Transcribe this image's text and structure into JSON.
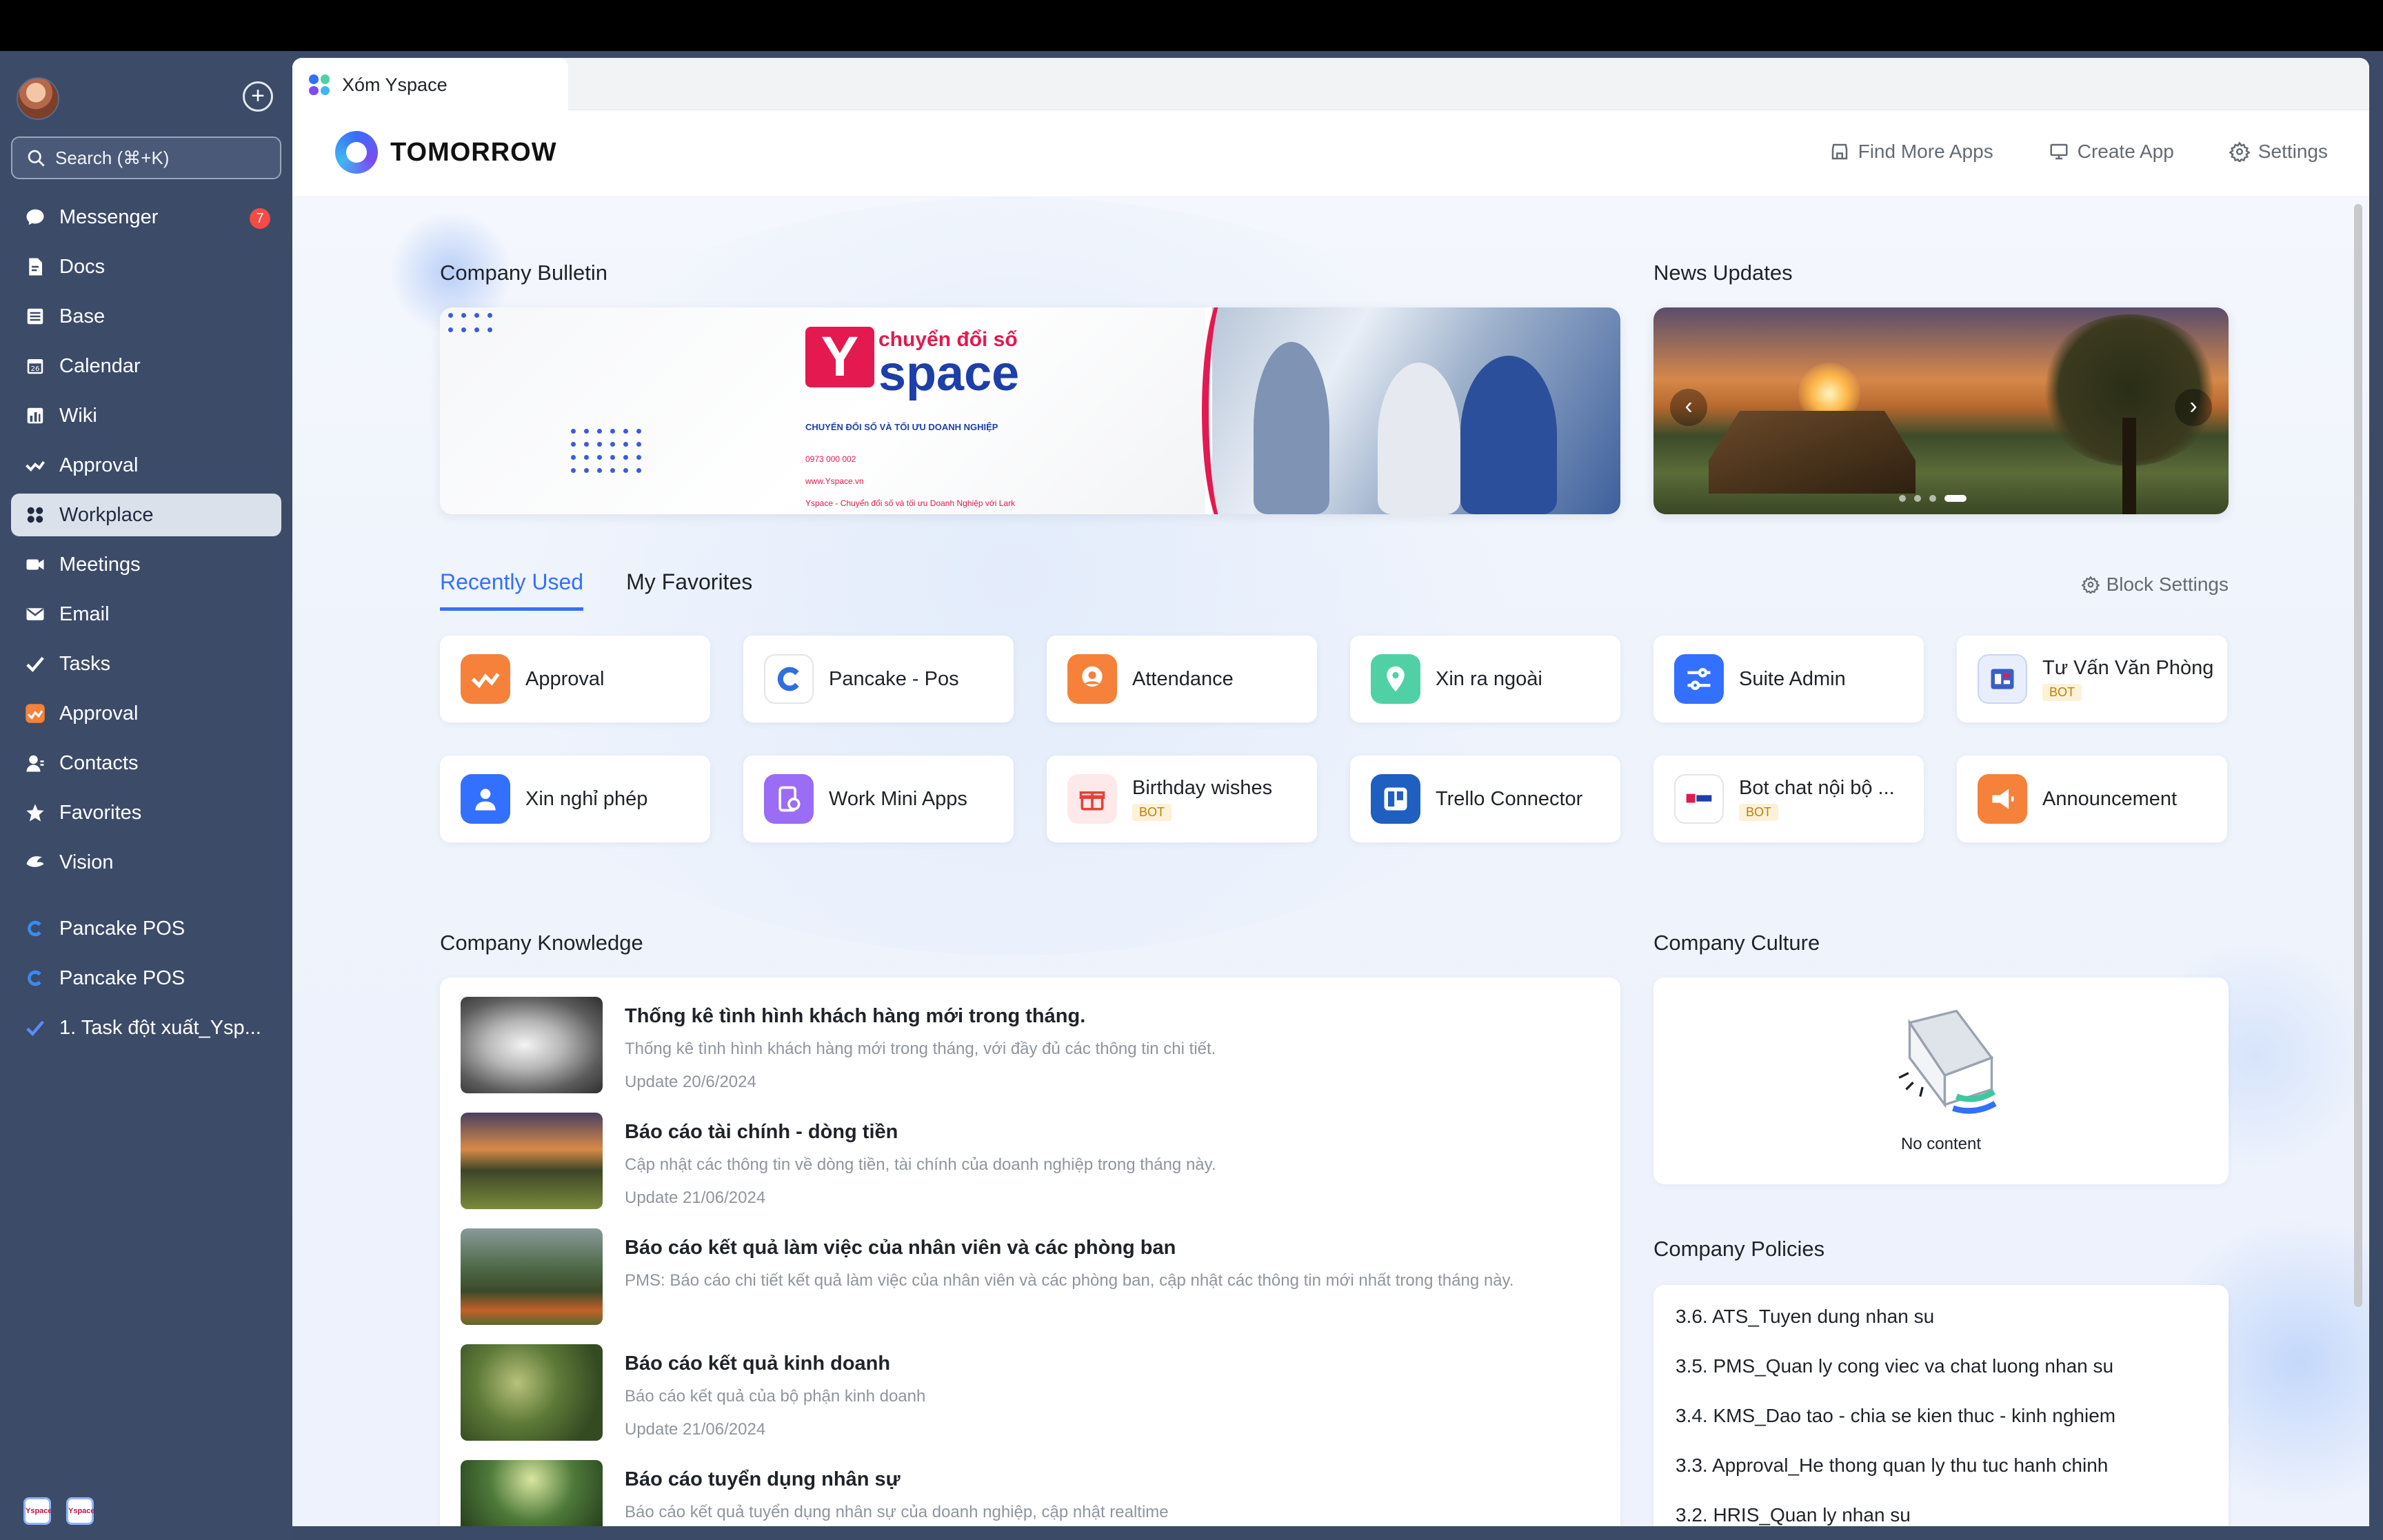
{
  "sidebar": {
    "search_label": "Search (⌘+K)",
    "items": [
      {
        "label": "Messenger",
        "icon": "chat-icon",
        "badge": "7"
      },
      {
        "label": "Docs",
        "icon": "docs-icon"
      },
      {
        "label": "Base",
        "icon": "base-icon"
      },
      {
        "label": "Calendar",
        "icon": "calendar-icon"
      },
      {
        "label": "Wiki",
        "icon": "wiki-icon"
      },
      {
        "label": "Approval",
        "icon": "approval-icon"
      },
      {
        "label": "Workplace",
        "icon": "workplace-icon",
        "active": true
      },
      {
        "label": "Meetings",
        "icon": "video-icon"
      },
      {
        "label": "Email",
        "icon": "mail-icon"
      },
      {
        "label": "Tasks",
        "icon": "check-icon"
      },
      {
        "label": "Approval",
        "icon": "approval-app-icon"
      },
      {
        "label": "Contacts",
        "icon": "contacts-icon"
      },
      {
        "label": "Favorites",
        "icon": "star-icon"
      },
      {
        "label": "Vision",
        "icon": "vision-icon"
      }
    ],
    "pinned": [
      {
        "label": "Pancake POS"
      },
      {
        "label": "Pancake POS"
      },
      {
        "label": "1. Task đột xuất_Ysp..."
      }
    ]
  },
  "window": {
    "tab_title": "Xóm Yspace"
  },
  "header": {
    "brand": "TOMORROW",
    "find_more_apps": "Find More Apps",
    "create_app": "Create App",
    "settings": "Settings"
  },
  "bulletin": {
    "title": "Company Bulletin",
    "banner": {
      "top": "chuyển đổi số",
      "y": "Y",
      "space": "space",
      "subtitle": "CHUYỂN ĐỔI SỐ VÀ TỐI ƯU DOANH NGHIỆP",
      "phone": "0973 000 002",
      "web": "www.Yspace.vn",
      "fb": "Yspace - Chuyển đổi số và tối ưu Doanh Nghiệp với Lark"
    }
  },
  "news": {
    "title": "News Updates",
    "prev": "‹",
    "next": "›",
    "pages": 4,
    "current_page": 4
  },
  "apps_section": {
    "tabs": [
      "Recently Used",
      "My Favorites"
    ],
    "active_tab": 0,
    "block_settings": "Block Settings",
    "apps": [
      {
        "name": "Approval",
        "icon": "approval-app-icon",
        "color": "#f5813a",
        "bot": ""
      },
      {
        "name": "Pancake - Pos",
        "icon": "pancake-icon",
        "color": "#ffffff",
        "bot": ""
      },
      {
        "name": "Attendance",
        "icon": "attendance-icon",
        "color": "#f5813a",
        "bot": ""
      },
      {
        "name": "Xin ra ngoài",
        "icon": "location-icon",
        "color": "#4fd1a5",
        "bot": ""
      },
      {
        "name": "Suite Admin",
        "icon": "admin-icon",
        "color": "#3370ff",
        "bot": ""
      },
      {
        "name": "Tư Vấn Văn Phòng",
        "icon": "office-bot-icon",
        "color": "#e8eefc",
        "bot": "BOT"
      },
      {
        "name": "Xin nghỉ phép",
        "icon": "leave-icon",
        "color": "#3370ff",
        "bot": ""
      },
      {
        "name": "Work Mini Apps",
        "icon": "mini-apps-icon",
        "color": "#9b6cf5",
        "bot": ""
      },
      {
        "name": "Birthday wishes",
        "icon": "gift-icon",
        "color": "#fde9e9",
        "bot": "BOT"
      },
      {
        "name": "Trello Connector",
        "icon": "trello-icon",
        "color": "#1f5fbf",
        "bot": ""
      },
      {
        "name": "Bot chat nội bộ ...",
        "icon": "yspace-bot-icon",
        "color": "#ffffff",
        "bot": "BOT"
      },
      {
        "name": "Announcement",
        "icon": "megaphone-icon",
        "color": "#f5813a",
        "bot": ""
      }
    ]
  },
  "knowledge": {
    "title": "Company Knowledge",
    "items": [
      {
        "title": "Thống kê tình hình khách hàng mới trong tháng.",
        "desc": "Thống kê tình hình khách hàng mới trong tháng, với đầy đủ các thông tin chi tiết.",
        "date": "Update 20/6/2024"
      },
      {
        "title": "Báo cáo tài chính - dòng tiền",
        "desc": "Cập nhật các thông tin về dòng tiền, tài chính của doanh nghiệp trong tháng này.",
        "date": "Update 21/06/2024"
      },
      {
        "title": "Báo cáo kết quả làm việc của nhân viên và các phòng ban",
        "desc": "PMS: Báo cáo chi tiết kết quả làm việc của nhân viên và các phòng ban, cập nhật các thông tin mới nhất trong tháng này.",
        "date": ""
      },
      {
        "title": "Báo cáo kết quả kinh doanh",
        "desc": "Báo cáo kết quả của bộ phận kinh doanh",
        "date": "Update 21/06/2024"
      },
      {
        "title": "Báo cáo tuyển dụng nhân sự",
        "desc": "Báo cáo kết quả tuyển dụng nhân sự của doanh nghiệp, cập nhật realtime",
        "date": ""
      }
    ]
  },
  "culture": {
    "title": "Company Culture",
    "empty": "No content"
  },
  "policies": {
    "title": "Company Policies",
    "items": [
      "3.6. ATS_Tuyen dung nhan su",
      "3.5. PMS_Quan ly cong viec va chat luong nhan su",
      "3.4. KMS_Dao tao - chia se kien thuc - kinh nghiem",
      "3.3. Approval_He thong quan ly thu tuc hanh chinh",
      "3.2. HRIS_Quan ly nhan su"
    ]
  },
  "bottom_logos": [
    "Yspace",
    "Yspace"
  ]
}
